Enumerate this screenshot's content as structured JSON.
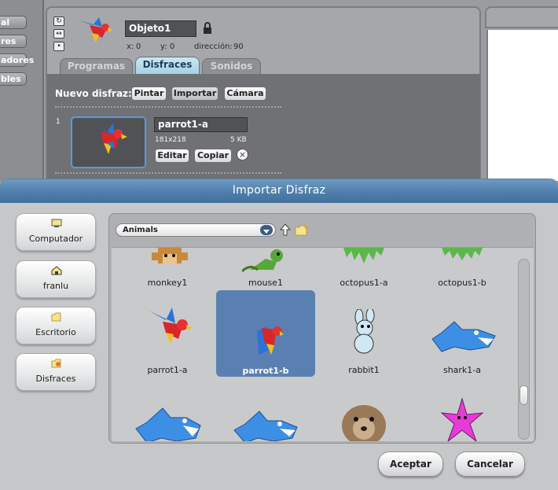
{
  "left_panel": {
    "buttons": [
      "al",
      "res",
      "adores",
      "bles"
    ]
  },
  "sprite": {
    "name": "Objeto1",
    "x_label": "x:",
    "x_value": "0",
    "y_label": "y:",
    "y_value": "0",
    "direction_label": "dirección:",
    "direction_value": "90"
  },
  "tabs": [
    "Programas",
    "Disfraces",
    "Sonidos"
  ],
  "costume_toolbar": {
    "label": "Nuevo disfraz:",
    "paint": "Pintar",
    "import": "Importar",
    "camera": "Cámara"
  },
  "costume": {
    "index": "1",
    "name": "parrot1-a",
    "dimensions": "181x218",
    "size": "5 KB",
    "edit": "Editar",
    "copy": "Copiar"
  },
  "dialog": {
    "title": "Importar Disfraz",
    "places": [
      "Computador",
      "franlu",
      "Escritorio",
      "Disfraces"
    ],
    "folder": "Animals",
    "accept": "Aceptar",
    "cancel": "Cancelar"
  },
  "files": {
    "row1": [
      "monkey1",
      "mouse1",
      "octopus1-a",
      "octopus1-b"
    ],
    "row2": [
      "parrot1-a",
      "parrot1-b",
      "rabbit1",
      "shark1-a"
    ],
    "selected": "parrot1-b"
  },
  "colors": {
    "title_bar": "#4f7eab",
    "selection": "#5a80b2",
    "shark": "#3d8fe6"
  }
}
